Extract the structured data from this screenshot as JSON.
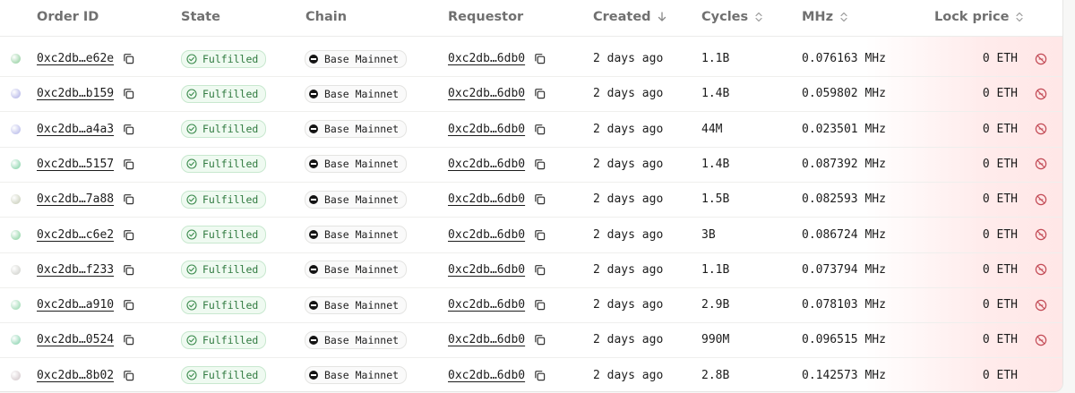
{
  "columns": {
    "order_id": "Order ID",
    "state": "State",
    "chain": "Chain",
    "requestor": "Requestor",
    "created": "Created",
    "cycles": "Cycles",
    "mhz": "MHz",
    "lock_price": "Lock price"
  },
  "colors": {
    "accent_green": "#2f7a3f",
    "badge_bg": "#effaf1",
    "warning_icon": "#c24a55"
  },
  "rows": [
    {
      "dot_color": "#a9d9b3",
      "order_id": "0xc2db…e62e",
      "state": "Fulfilled",
      "chain": "Base Mainnet",
      "requestor": "0xc2db…6db0",
      "created": "2 days ago",
      "cycles": "1.1B",
      "mhz": "0.076163 MHz",
      "lock_price": "0 ETH",
      "flag_icon": "no-entry-icon"
    },
    {
      "dot_color": "#c2c3ec",
      "order_id": "0xc2db…b159",
      "state": "Fulfilled",
      "chain": "Base Mainnet",
      "requestor": "0xc2db…6db0",
      "created": "2 days ago",
      "cycles": "1.4B",
      "mhz": "0.059802 MHz",
      "lock_price": "0 ETH",
      "flag_icon": "no-entry-icon"
    },
    {
      "dot_color": "#c6c8ee",
      "order_id": "0xc2db…a4a3",
      "state": "Fulfilled",
      "chain": "Base Mainnet",
      "requestor": "0xc2db…6db0",
      "created": "2 days ago",
      "cycles": "44M",
      "mhz": "0.023501 MHz",
      "lock_price": "0 ETH",
      "flag_icon": "no-entry-icon"
    },
    {
      "dot_color": "#9fdcbb",
      "order_id": "0xc2db…5157",
      "state": "Fulfilled",
      "chain": "Base Mainnet",
      "requestor": "0xc2db…6db0",
      "created": "2 days ago",
      "cycles": "1.4B",
      "mhz": "0.087392 MHz",
      "lock_price": "0 ETH",
      "flag_icon": "no-entry-icon"
    },
    {
      "dot_color": "#d4d8c8",
      "order_id": "0xc2db…7a88",
      "state": "Fulfilled",
      "chain": "Base Mainnet",
      "requestor": "0xc2db…6db0",
      "created": "2 days ago",
      "cycles": "1.5B",
      "mhz": "0.082593 MHz",
      "lock_price": "0 ETH",
      "flag_icon": "no-entry-icon"
    },
    {
      "dot_color": "#a4dcb6",
      "order_id": "0xc2db…c6e2",
      "state": "Fulfilled",
      "chain": "Base Mainnet",
      "requestor": "0xc2db…6db0",
      "created": "2 days ago",
      "cycles": "3B",
      "mhz": "0.086724 MHz",
      "lock_price": "0 ETH",
      "flag_icon": "no-entry-icon"
    },
    {
      "dot_color": "#d9dad6",
      "order_id": "0xc2db…f233",
      "state": "Fulfilled",
      "chain": "Base Mainnet",
      "requestor": "0xc2db…6db0",
      "created": "2 days ago",
      "cycles": "1.1B",
      "mhz": "0.073794 MHz",
      "lock_price": "0 ETH",
      "flag_icon": "no-entry-icon"
    },
    {
      "dot_color": "#aee0c1",
      "order_id": "0xc2db…a910",
      "state": "Fulfilled",
      "chain": "Base Mainnet",
      "requestor": "0xc2db…6db0",
      "created": "2 days ago",
      "cycles": "2.9B",
      "mhz": "0.078103 MHz",
      "lock_price": "0 ETH",
      "flag_icon": "no-entry-icon"
    },
    {
      "dot_color": "#a2dcc0",
      "order_id": "0xc2db…0524",
      "state": "Fulfilled",
      "chain": "Base Mainnet",
      "requestor": "0xc2db…6db0",
      "created": "2 days ago",
      "cycles": "990M",
      "mhz": "0.096515 MHz",
      "lock_price": "0 ETH",
      "flag_icon": "no-entry-icon"
    },
    {
      "dot_color": "#dcd3d6",
      "order_id": "0xc2db…8b02",
      "state": "Fulfilled",
      "chain": "Base Mainnet",
      "requestor": "0xc2db…6db0",
      "created": "2 days ago",
      "cycles": "2.8B",
      "mhz": "0.142573 MHz",
      "lock_price": "0 ETH",
      "flag_icon": ""
    }
  ]
}
